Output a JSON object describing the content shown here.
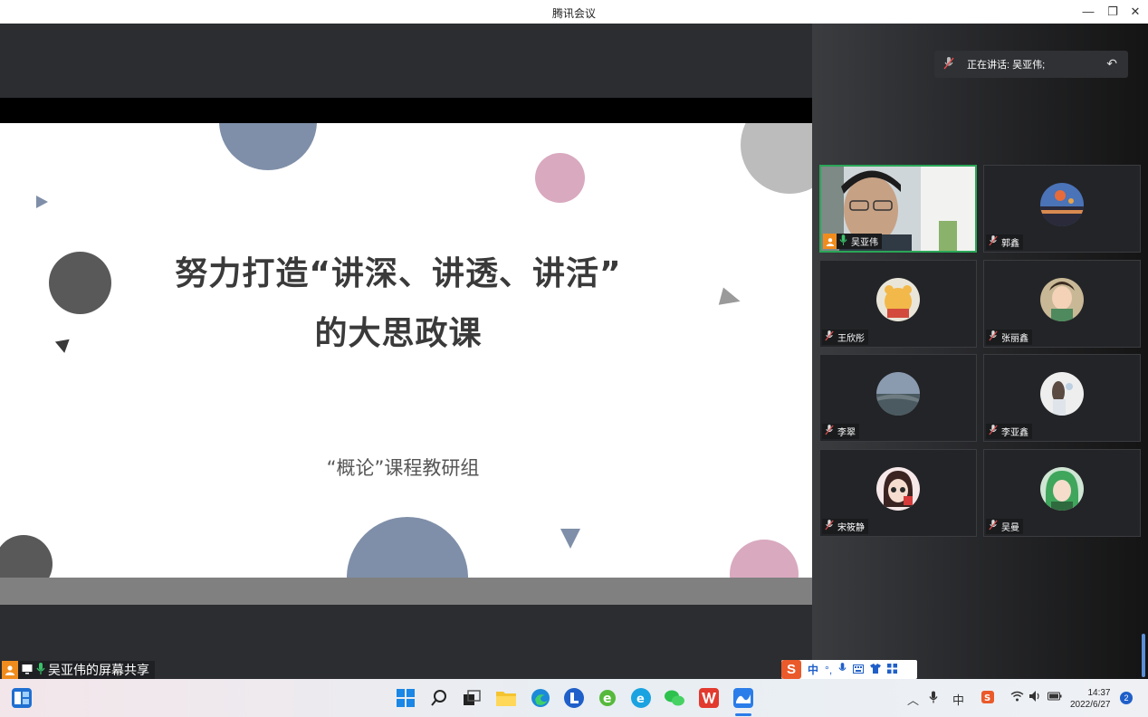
{
  "window": {
    "title": "腾讯会议",
    "minimize_icon": "—",
    "restore_icon": "❐",
    "close_icon": "✕"
  },
  "slide": {
    "title_line1": "努力打造“讲深、讲透、讲活”",
    "title_line2": "的大思政课",
    "subtitle": "“概论”课程教研组"
  },
  "share_label": "吴亚伟的屏幕共享",
  "speaking": {
    "text": "正在讲话: 吴亚伟;"
  },
  "participants": [
    {
      "name": "吴亚伟",
      "video_on": true
    },
    {
      "name": "郭鑫",
      "video_on": false
    },
    {
      "name": "王欣彤",
      "video_on": false
    },
    {
      "name": "张丽鑫",
      "video_on": false
    },
    {
      "name": "李翠",
      "video_on": false
    },
    {
      "name": "李亚鑫",
      "video_on": false
    },
    {
      "name": "宋筱静",
      "video_on": false
    },
    {
      "name": "吴曼",
      "video_on": false
    }
  ],
  "ime": {
    "logo": "S",
    "mode": "中",
    "punct": "°,"
  },
  "taskbar": {
    "time": "14:37",
    "date": "2022/6/27",
    "notification_count": "2",
    "ime_tray": "中"
  },
  "colors": {
    "speaking_border": "#2aa657",
    "slide_blue": "#7f8fa9",
    "slide_pink": "#d9a9bf",
    "slide_gray": "#b9b9b9",
    "slide_dark": "#595959"
  }
}
